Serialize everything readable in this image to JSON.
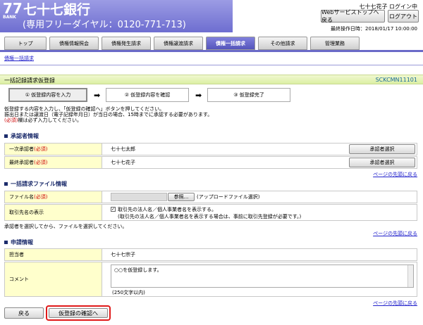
{
  "header": {
    "bank_number": "77",
    "bank_sub": "BANK",
    "bank_name": "七十七銀行",
    "toll_free": "(専用フリーダイヤル：0120-771-713)",
    "user_status": "七十七花子 ログイン中",
    "webservice_stop_label": "Webサービストップへ戻る",
    "logout_label": "ログアウト",
    "last_login": "最終操作日時：2018/01/17 10:00:00"
  },
  "tabs": [
    "トップ",
    "債権情報照会",
    "債権発生請求",
    "債権譲渡請求",
    "債権一括請求",
    "その他請求",
    "管理業務"
  ],
  "active_tab": "債権一括請求",
  "subnav": "債権一括請求",
  "page": {
    "title": "一括記録請求仮登録",
    "screen_id": "SCKCMN11101"
  },
  "steps": [
    "① 仮登録内容を入力",
    "② 仮登録内容を確認",
    "③ 仮登録完了"
  ],
  "notes": {
    "line1": "仮登録する内容を入力し、「仮登録の確認へ」ボタンを押してください。",
    "line2": "振出日または譲渡日（電子記録年月日）が当日の場合、15時までに承認する必要があります。",
    "required_mark": "(必須)",
    "line3_rest": "欄は必ず入力してください。"
  },
  "approver": {
    "heading": "承認者情報",
    "first_label": "一次承認者",
    "required": "(必須)",
    "first_value": "七十七太郎",
    "final_label": "最終承認者",
    "final_value": "七十七花子",
    "select_button": "承認者選択",
    "top_link": "ページの先頭に戻る"
  },
  "file": {
    "heading": "一括請求ファイル情報",
    "file_label": "ファイル名",
    "required": "(必須)",
    "browse_button": "参照...",
    "file_hint": "(アップロードファイル選択)",
    "display_label": "取引先名の表示",
    "checkbox_label": "取引先の法人名／個人事業者名を表示する。",
    "checkbox_note": "(取引先の法人名／個人事業者名を表示する場合は、事前に取引先登録が必要です。)",
    "after_note": "承認者を選択してから、ファイルを選択してください。",
    "top_link": "ページの先頭に戻る"
  },
  "application": {
    "heading": "申請情報",
    "person_label": "担当者",
    "person_value": "七十七宗子",
    "comment_label": "コメント",
    "comment_value": "○○を仮登録します。",
    "comment_limit": "(250文字以内)",
    "top_link": "ページの先頭に戻る"
  },
  "footer": {
    "back_label": "戻る",
    "confirm_label": "仮登録の確認へ"
  }
}
